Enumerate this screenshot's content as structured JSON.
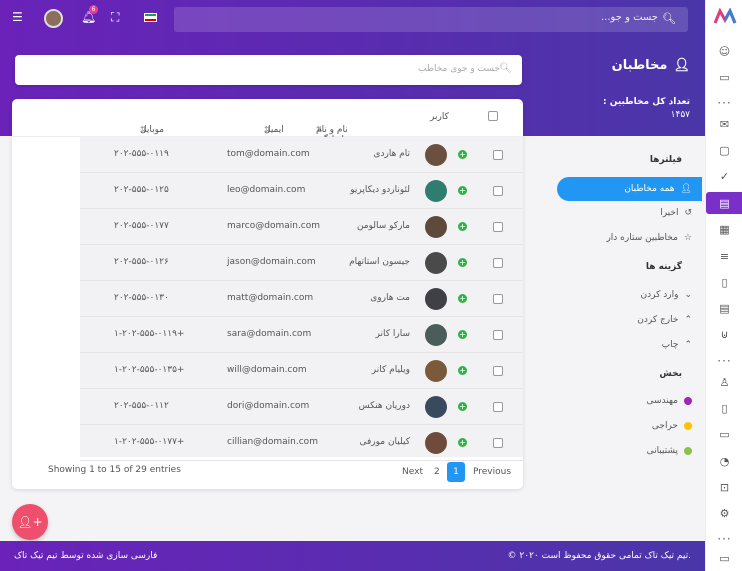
{
  "topbar": {
    "search_placeholder": "جست و جو...",
    "notification_count": "6"
  },
  "page": {
    "title": "مخاطبان",
    "total_label": "تعداد کل مخاطبین :",
    "total_value": "۱۴۵۷",
    "contact_search_placeholder": "جست و جوی مخاطب"
  },
  "table": {
    "headers": {
      "user": "کاربر",
      "name": "نام و نام خانوادگی",
      "email": "ایمیل",
      "mobile": "موبایل"
    },
    "rows": [
      {
        "name": "تام هاردی",
        "email": "tom@domain.com",
        "mobile": "۲۰۲-۵۵۵-۰۱۱۹",
        "avatar_color": "#6b4f3f"
      },
      {
        "name": "لئوناردو دیکاپریو",
        "email": "leo@domain.com",
        "mobile": "۲۰۲-۵۵۵-۰۱۲۵",
        "avatar_color": "#2e7d6f"
      },
      {
        "name": "مارکو سالومن",
        "email": "marco@domain.com",
        "mobile": "۲۰۲-۵۵۵-۰۱۷۷",
        "avatar_color": "#5d4a3a"
      },
      {
        "name": "جیسون استاتهام",
        "email": "jason@domain.com",
        "mobile": "۲۰۲-۵۵۵-۰۱۲۶",
        "avatar_color": "#4a4a4a"
      },
      {
        "name": "مت هاروی",
        "email": "matt@domain.com",
        "mobile": "۲۰۲-۵۵۵-۰۱۳۰",
        "avatar_color": "#3f3f46"
      },
      {
        "name": "سارا کانر",
        "email": "sara@domain.com",
        "mobile": "۱-۲۰۲-۵۵۵-۰۱۱۹+",
        "avatar_color": "#4b5d5a"
      },
      {
        "name": "ویلیام کانر",
        "email": "will@domain.com",
        "mobile": "۱-۲۰۲-۵۵۵-۰۱۳۵+",
        "avatar_color": "#7a5a3a"
      },
      {
        "name": "دوریان هنکس",
        "email": "dori@domain.com",
        "mobile": "۲۰۲-۵۵۵-۰۱۱۲",
        "avatar_color": "#3a4a5e"
      },
      {
        "name": "کیلیان مورفی",
        "email": "cillian@domain.com",
        "mobile": "۱-۲۰۲-۵۵۵-۰۱۷۷+",
        "avatar_color": "#6e4b3a"
      }
    ],
    "footer_info": "Showing 1 to 15 of 29 entries",
    "pagination": {
      "next": "Next",
      "page2": "2",
      "page1": "1",
      "previous": "Previous"
    }
  },
  "filters": {
    "section_title": "فیلترها",
    "items": [
      {
        "label": "همه مخاطبان",
        "icon": "user-icon"
      },
      {
        "label": "اخیرا",
        "icon": "history-icon"
      },
      {
        "label": "مخاطبین ستاره دار",
        "icon": "star-icon"
      }
    ]
  },
  "options": {
    "section_title": "گزینه ها",
    "items": [
      {
        "label": "وارد کردن",
        "icon": "chevron-down-icon"
      },
      {
        "label": "خارج کردن",
        "icon": "chevron-up-icon"
      },
      {
        "label": "چاپ",
        "icon": "chevron-up-icon"
      }
    ]
  },
  "departments": {
    "section_title": "بخش",
    "items": [
      {
        "label": "مهندسی",
        "color": "#9c27b0"
      },
      {
        "label": "حراجی",
        "color": "#ffc107"
      },
      {
        "label": "پشتیبانی",
        "color": "#8bc34a"
      }
    ]
  },
  "footer": {
    "copyright": "© ۲۰۲۰ تیم تیک تاک تمامی حقوق محفوظ است.",
    "credit": "فارسی سازی شده توسط تیم تیک تاک"
  },
  "colors": {
    "accent": "#2196f3",
    "brand": "#6a22b9",
    "fab": "#ee4f6c"
  }
}
